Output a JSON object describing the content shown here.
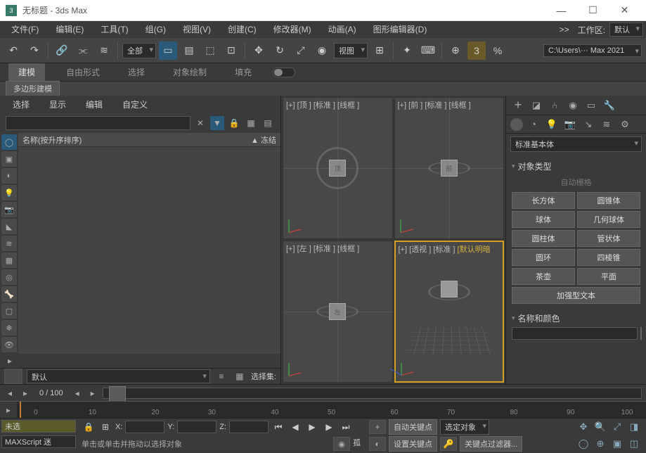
{
  "titlebar": {
    "title": "无标题 - 3ds Max"
  },
  "menubar": {
    "items": [
      "文件(F)",
      "编辑(E)",
      "工具(T)",
      "组(G)",
      "视图(V)",
      "创建(C)",
      "修改器(M)",
      "动画(A)",
      "图形编辑器(D)"
    ],
    "more": ">>",
    "workspace_label": "工作区:",
    "workspace_value": "默认"
  },
  "toolbar": {
    "scope": "全部",
    "view_sel": "视图",
    "path": "C:\\Users\\··· Max 2021"
  },
  "ribbon": {
    "tabs": [
      "建模",
      "自由形式",
      "选择",
      "对象绘制",
      "填充"
    ]
  },
  "subbar": {
    "tab": "多边形建模"
  },
  "left": {
    "tabs": [
      "选择",
      "显示",
      "编辑",
      "自定义"
    ],
    "list_header_name": "名称(按升序排序)",
    "list_header_frozen": "▲ 冻结",
    "layer_default": "默认",
    "selset_label": "选择集:"
  },
  "viewports": {
    "top": "[+] [顶 ] [标准 ] [线框 ]",
    "front": "[+] [前 ] [标准 ] [线框 ]",
    "left": "[+] [左 ] [标准 ] [线框 ]",
    "persp_a": "[+] [透视 ] [标准 ] ",
    "persp_b": "[默认明暗",
    "cube_top": "顶",
    "cube_front": "前",
    "cube_left": "左"
  },
  "right": {
    "primitive_dropdown": "标准基本体",
    "section_objtype": "对象类型",
    "autogrid": "自动栅格",
    "buttons": [
      "长方体",
      "圆锥体",
      "球体",
      "几何球体",
      "圆柱体",
      "管状体",
      "圆环",
      "四棱锥",
      "茶壶",
      "平面"
    ],
    "btn_text": "加强型文本",
    "section_namecolor": "名称和颜色"
  },
  "timeline": {
    "count": "0 / 100"
  },
  "ruler": {
    "ticks": [
      "0",
      "10",
      "20",
      "30",
      "40",
      "50",
      "60",
      "70",
      "80",
      "90",
      "100"
    ]
  },
  "bottom": {
    "input1": "未选",
    "maxscript": "MAXScript 迷",
    "x": "X:",
    "y": "Y:",
    "z": "Z:",
    "status": "单击或单击并拖动以选择对象",
    "isolate": "孤",
    "autokey": "自动关键点",
    "selobj": "选定对象",
    "setkey": "设置关键点",
    "keyfilter": "关键点过滤器..."
  }
}
